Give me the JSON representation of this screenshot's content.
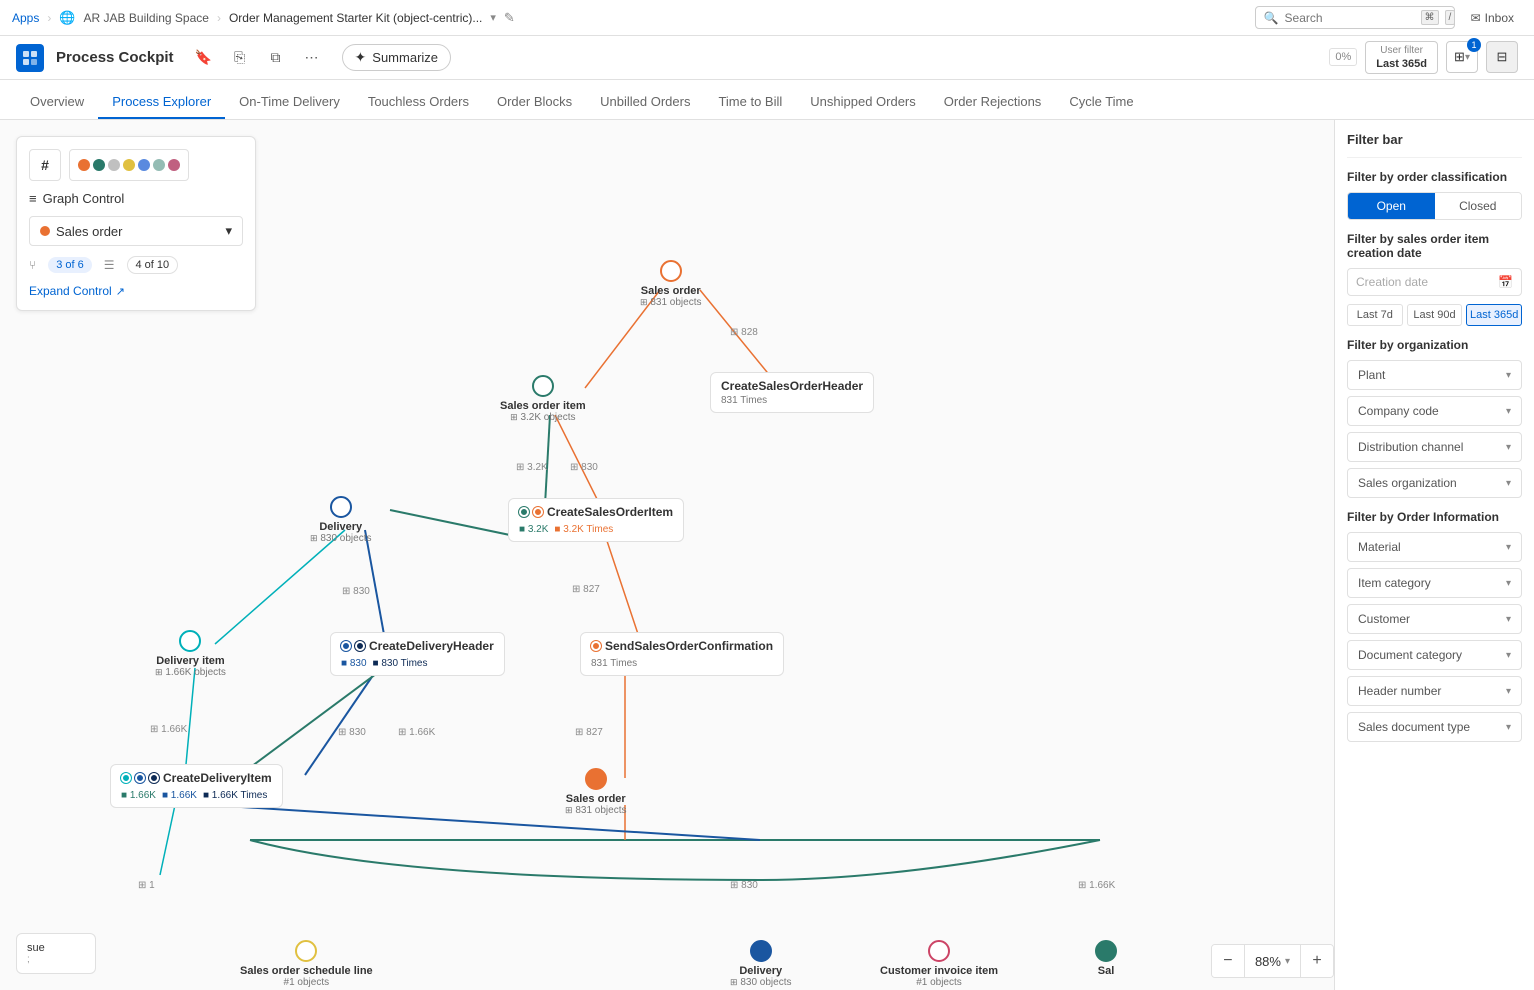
{
  "topbar": {
    "apps_label": "Apps",
    "nav1": "AR JAB Building Space",
    "nav2": "Order Management Starter Kit (object-centric)...",
    "search_placeholder": "Search",
    "inbox_label": "Inbox",
    "kbd1": "⌘",
    "kbd2": "/"
  },
  "toolbar": {
    "title": "Process Cockpit",
    "summarize_label": "Summarize",
    "user_filter_label": "User filter",
    "user_filter_value": "Last 365d",
    "pct": "0%",
    "filter_bar_label": "Filter bar",
    "filter_badge": "1"
  },
  "tabs": [
    {
      "label": "Overview",
      "active": false
    },
    {
      "label": "Process Explorer",
      "active": true
    },
    {
      "label": "On-Time Delivery",
      "active": false
    },
    {
      "label": "Touchless Orders",
      "active": false
    },
    {
      "label": "Order Blocks",
      "active": false
    },
    {
      "label": "Unbilled Orders",
      "active": false
    },
    {
      "label": "Time to Bill",
      "active": false
    },
    {
      "label": "Unshipped Orders",
      "active": false
    },
    {
      "label": "Order Rejections",
      "active": false
    },
    {
      "label": "Cycle Time",
      "active": false
    }
  ],
  "graph_control": {
    "title": "Graph Control",
    "dropdown_value": "Sales order",
    "badge1_label": "3 of 6",
    "badge2_label": "4 of 10",
    "expand_label": "Expand Control"
  },
  "nodes": {
    "sales_order": {
      "label": "Sales order",
      "count": "831 objects"
    },
    "sales_order_item": {
      "label": "Sales order item",
      "count": "3.2K objects"
    },
    "delivery": {
      "label": "Delivery",
      "count": "830 objects"
    },
    "delivery_item": {
      "label": "Delivery item",
      "count": "1.66K objects"
    },
    "sales_order_schedule": {
      "label": "Sales order schedule line",
      "count": "#1 objects"
    },
    "delivery_bottom": {
      "label": "Delivery",
      "count": "830 objects"
    },
    "customer_invoice": {
      "label": "Customer invoice item",
      "count": "#1 objects"
    },
    "sales_bottom": {
      "label": "Sal",
      "count": ""
    },
    "sales_order_bottom": {
      "label": "Sales order",
      "count": "831 objects"
    },
    "create_sales_header": {
      "label": "CreateSalesOrderHeader",
      "count": "831 Times"
    },
    "create_sales_item": {
      "label": "CreateSalesOrderItem",
      "teal": "3.2K",
      "orange": "3.2K Times"
    },
    "create_delivery_header": {
      "label": "CreateDeliveryHeader",
      "blue": "830",
      "navy": "830 Times"
    },
    "send_confirmation": {
      "label": "SendSalesOrderConfirmation",
      "count": "831 Times"
    },
    "create_delivery_item": {
      "label": "CreateDeliveryItem",
      "teal": "1.66K",
      "blue": "1.66K",
      "navy": "1.66K Times"
    }
  },
  "edge_labels": {
    "e1": "828",
    "e2": "3.2K",
    "e3": "830",
    "e4": "830",
    "e5": "1.66K",
    "e6": "827",
    "e7": "827",
    "e8": "1.66K",
    "e9": "1",
    "e10": "830",
    "e11": "1.66K"
  },
  "filter_sidebar": {
    "title": "Filter bar",
    "order_classification": "Filter by order classification",
    "open_label": "Open",
    "closed_label": "Closed",
    "creation_date_section": "Filter by sales order item creation date",
    "creation_date_placeholder": "Creation date",
    "date_btn1": "Last 7d",
    "date_btn2": "Last 90d",
    "date_btn3": "Last 365d",
    "organization_section": "Filter by organization",
    "plant": "Plant",
    "company_code": "Company code",
    "distribution_channel": "Distribution channel",
    "sales_organization": "Sales organization",
    "order_info_section": "Filter by Order Information",
    "material": "Material",
    "item_category": "Item category",
    "customer": "Customer",
    "document_category": "Document category",
    "header_number": "Header number",
    "sales_document_type": "Sales document type"
  },
  "zoom": {
    "value": "88%"
  },
  "user_card": {
    "name": "sue",
    "extra": ";"
  }
}
